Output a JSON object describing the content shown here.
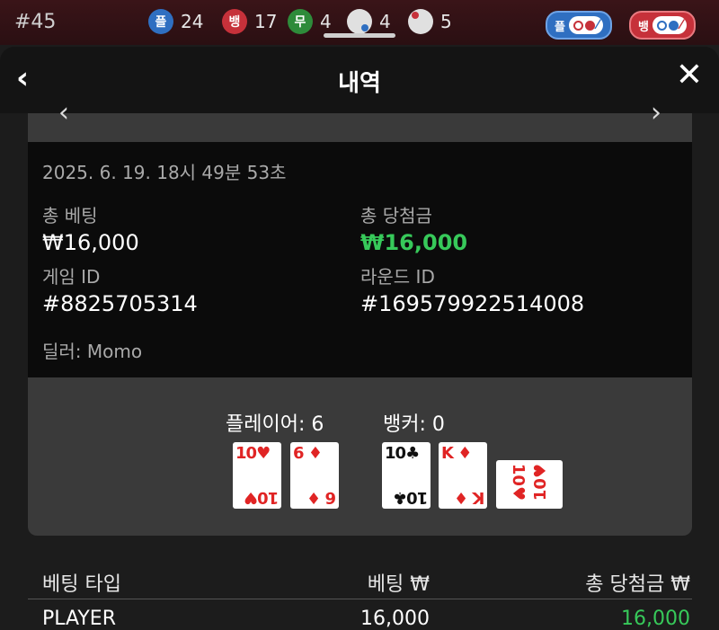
{
  "topbar": {
    "round": "#45",
    "stats": [
      {
        "badge": "플",
        "color": "#2f6fc1",
        "count": "24"
      },
      {
        "badge": "뱅",
        "color": "#c6313a",
        "count": "17"
      },
      {
        "badge": "무",
        "color": "#2e8b3a",
        "count": "4"
      },
      {
        "badge": "",
        "color": "#e0e0e0",
        "count": "4"
      },
      {
        "badge": "",
        "color": "#e0e0e0",
        "count": "5"
      }
    ],
    "pill_player": "플",
    "pill_banker": "뱅"
  },
  "modal": {
    "title": "내역",
    "back_icon": "‹",
    "close_icon": "✕"
  },
  "info": {
    "datetime": "2025. 6. 19. 18시 49분 53초",
    "total_bet_label": "총 베팅",
    "total_bet_value": "₩16,000",
    "total_win_label": "총 당첨금",
    "total_win_value": "₩16,000",
    "game_id_label": "게임 ID",
    "game_id_value": "#8825705314",
    "round_id_label": "라운드 ID",
    "round_id_value": "#169579922514008",
    "dealer": "딜러: Momo"
  },
  "result": {
    "player_score": "플레이어: 6",
    "banker_score": "뱅커: 0",
    "player_cards": [
      {
        "rank": "10",
        "suit": "♥",
        "color": "red"
      },
      {
        "rank": "6",
        "suit": "♦",
        "color": "red"
      }
    ],
    "banker_cards": [
      {
        "rank": "10",
        "suit": "♣",
        "color": "black"
      },
      {
        "rank": "K",
        "suit": "♦",
        "color": "red"
      },
      {
        "rank": "10",
        "suit": "♥",
        "color": "red"
      }
    ]
  },
  "table": {
    "headers": [
      "베팅 타입",
      "베팅 ₩",
      "총 당첨금 ₩"
    ],
    "rows": [
      {
        "type": "PLAYER",
        "bet": "16,000",
        "win": "16,000"
      }
    ]
  },
  "colors": {
    "win_green": "#37c95a",
    "player_blue": "#2f6fc1",
    "banker_red": "#c6313a"
  }
}
